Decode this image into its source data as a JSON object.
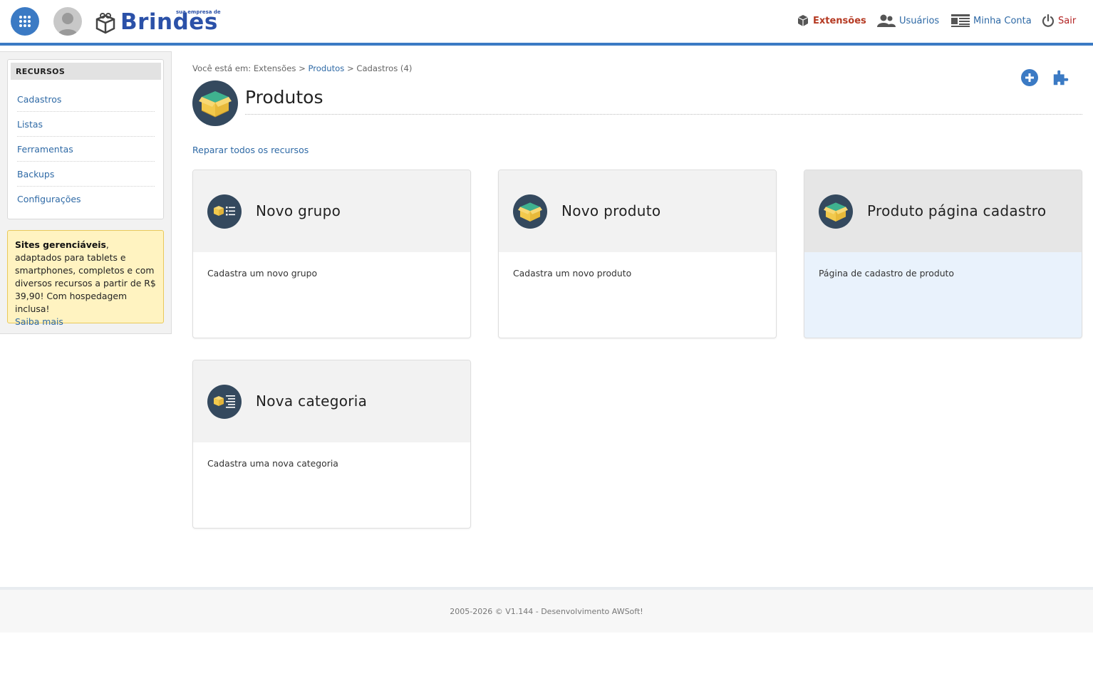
{
  "header": {
    "logo_text": "Brindes",
    "logo_tagline": "sua empresa de",
    "nav": [
      {
        "label": "Extensões",
        "icon": "cube-icon"
      },
      {
        "label": "Usuários",
        "icon": "users-icon"
      },
      {
        "label": "Minha Conta",
        "icon": "account-card-icon"
      },
      {
        "label": "Sair",
        "icon": "power-icon"
      }
    ],
    "colors": {
      "accent": "#3b7ac4",
      "active_nav": "#b53a23",
      "exit": "#b22222"
    }
  },
  "sidebar": {
    "title": "RECURSOS",
    "items": [
      "Cadastros",
      "Listas",
      "Ferramentas",
      "Backups",
      "Configurações"
    ],
    "promo": {
      "bold": "Sites gerenciáveis",
      "text": ", adaptados para tablets e smartphones, completos e com diversos recursos a partir de R$ 39,90! Com hospedagem inclusa!",
      "link": "Saiba mais"
    }
  },
  "main": {
    "breadcrumb": {
      "prefix": "Você está em: Extensões",
      "sep": ">",
      "link": "Produtos",
      "current": "Cadastros (4)"
    },
    "title": "Produtos",
    "repair_link": "Reparar todos os recursos",
    "cards": [
      {
        "title": "Novo grupo",
        "desc": "Cadastra um novo grupo",
        "icon": "group-list-icon"
      },
      {
        "title": "Novo produto",
        "desc": "Cadastra um novo produto",
        "icon": "product-box-icon"
      },
      {
        "title": "Produto página cadastro",
        "desc": "Página de cadastro de produto",
        "icon": "product-box-icon"
      },
      {
        "title": "Nova categoria",
        "desc": "Cadastra uma nova categoria",
        "icon": "category-list-icon"
      }
    ]
  },
  "footer": {
    "text": "2005-2026 © V1.144 - Desenvolvimento AWSoft!"
  }
}
